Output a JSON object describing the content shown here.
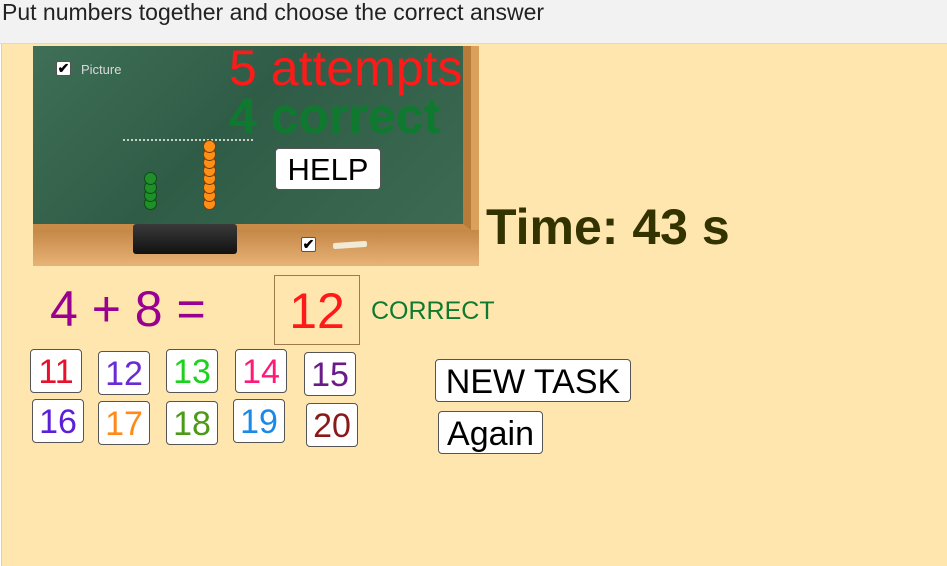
{
  "header": {
    "title": "Put numbers together and choose the correct answer"
  },
  "board": {
    "picture_label": "Picture",
    "picture_checked": "✔",
    "bottom_checked": "✔",
    "green_beads": 4,
    "orange_beads": 8,
    "colors": {
      "green": "#1f8f2a",
      "orange": "#ff8f17"
    }
  },
  "status": {
    "attempts": "5 attempts",
    "correct": "4 correct",
    "time": "Time: 43 s"
  },
  "buttons": {
    "help": "HELP",
    "new_task": "NEW TASK",
    "again": "Again"
  },
  "task": {
    "equation": "4 + 8 =",
    "answer": "12",
    "result": "CORRECT"
  },
  "numbers": [
    {
      "label": "11",
      "color": "#e8102a"
    },
    {
      "label": "12",
      "color": "#6a2bd6"
    },
    {
      "label": "13",
      "color": "#1fd11f"
    },
    {
      "label": "14",
      "color": "#ff1a7a"
    },
    {
      "label": "15",
      "color": "#6a1b8a"
    },
    {
      "label": "16",
      "color": "#5a1fd6"
    },
    {
      "label": "17",
      "color": "#ff8a1a"
    },
    {
      "label": "18",
      "color": "#4c9a1a"
    },
    {
      "label": "19",
      "color": "#1a8ae8"
    },
    {
      "label": "20",
      "color": "#8a1a1a"
    }
  ]
}
